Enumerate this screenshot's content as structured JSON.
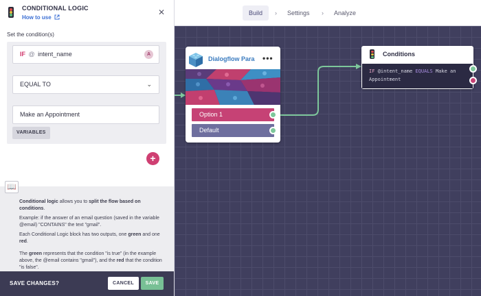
{
  "panel": {
    "title": "CONDITIONAL LOGIC",
    "how_to": "How to use",
    "set_label": "Set the condition(s)",
    "if_keyword": "IF",
    "at_symbol": "@",
    "variable": "intent_name",
    "variable_badge": "A",
    "operator": "EQUAL TO",
    "value": "Make an Appointment",
    "variables_button": "VARIABLES",
    "add_button": "+",
    "info": {
      "p1_bold1": "Conditional logic",
      "p1_text1": " allows you to ",
      "p1_bold2": "split the flow based on conditions",
      "p1_text2": ".",
      "p2": "Example: if the answer of an email question (saved in the variable @email) \"CONTAINS\" the text \"gmail\".",
      "p3_text1": "Each Conditional Logic block has two outputs, one ",
      "p3_bold1": "green",
      "p3_text2": " and one ",
      "p3_bold2": "red",
      "p3_text3": ".",
      "p4_text1": "The ",
      "p4_bold1": "green",
      "p4_text2": " represents that the condition \"is true\" (in the example above, the @email contains \"gmail\"), and the ",
      "p4_bold2": "red",
      "p4_text3": " that the condition \"is false\"."
    },
    "footer": {
      "question": "SAVE CHANGES?",
      "cancel": "CANCEL",
      "save": "SAVE"
    }
  },
  "nav": {
    "steps": [
      "Build",
      "Settings",
      "Analyze"
    ],
    "active": "Build",
    "separator": "›"
  },
  "nodes": {
    "dialogflow": {
      "title": "Dialogflow Para",
      "menu": "•••",
      "options": [
        "Option 1",
        "Default"
      ]
    },
    "conditions": {
      "title": "Conditions",
      "if": "IF",
      "variable": "@intent_name",
      "operator": "EQUALS",
      "value": "Make an Appointment"
    }
  },
  "colors": {
    "canvas": "#403f5e",
    "accent_pink": "#c64275",
    "green": "#7dc79b",
    "option_default": "#6e6f9e",
    "link_blue": "#3b6fd4"
  }
}
